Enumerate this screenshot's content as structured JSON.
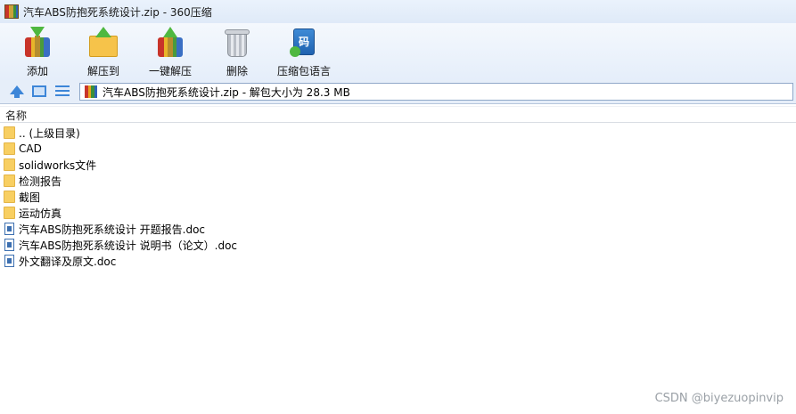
{
  "window": {
    "title": "汽车ABS防抱死系统设计.zip - 360压缩"
  },
  "toolbar": {
    "buttons": [
      {
        "label": "添加",
        "icon": "add-archive-icon"
      },
      {
        "label": "解压到",
        "icon": "extract-to-folder-icon"
      },
      {
        "label": "一键解压",
        "icon": "one-click-extract-icon"
      },
      {
        "label": "删除",
        "icon": "trash-icon"
      },
      {
        "label": "压缩包语言",
        "icon": "archive-language-icon"
      }
    ]
  },
  "addressbar": {
    "path": "汽车ABS防抱死系统设计.zip - 解包大小为 28.3 MB"
  },
  "list": {
    "column_name": "名称",
    "items": [
      {
        "name": ".. (上级目录)",
        "type": "folder"
      },
      {
        "name": "CAD",
        "type": "folder"
      },
      {
        "name": "solidworks文件",
        "type": "folder"
      },
      {
        "name": "检测报告",
        "type": "folder"
      },
      {
        "name": "截图",
        "type": "folder"
      },
      {
        "name": "运动仿真",
        "type": "folder"
      },
      {
        "name": "汽车ABS防抱死系统设计 开题报告.doc",
        "type": "doc"
      },
      {
        "name": "汽车ABS防抱死系统设计 说明书（论文）.doc",
        "type": "doc"
      },
      {
        "name": "外文翻译及原文.doc",
        "type": "doc"
      }
    ]
  },
  "watermark": "CSDN @biyezuopinvip"
}
